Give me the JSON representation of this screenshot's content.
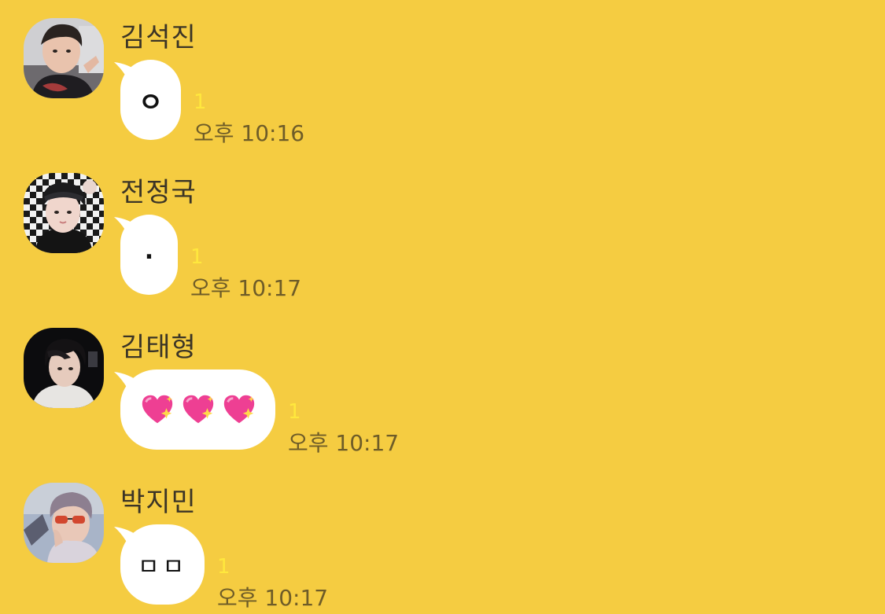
{
  "messages": [
    {
      "sender": "김석진",
      "avatar_icon": "profile-photo-jin",
      "text": "ㅇ",
      "unread": "1",
      "time": "오후 10:16"
    },
    {
      "sender": "전정국",
      "avatar_icon": "profile-photo-jungkook",
      "text": ".",
      "unread": "1",
      "time": "오후 10:17"
    },
    {
      "sender": "김태형",
      "avatar_icon": "profile-photo-taehyung",
      "text": "💖💖💖",
      "unread": "1",
      "time": "오후 10:17"
    },
    {
      "sender": "박지민",
      "avatar_icon": "profile-photo-jimin",
      "text": "ㅁㅁ",
      "unread": "1",
      "time": "오후 10:17"
    }
  ],
  "colors": {
    "background": "#F5CC41",
    "bubble": "#FFFFFF",
    "unread": "#FFE83D",
    "time": "#6E5C28",
    "name": "#3B3426"
  }
}
